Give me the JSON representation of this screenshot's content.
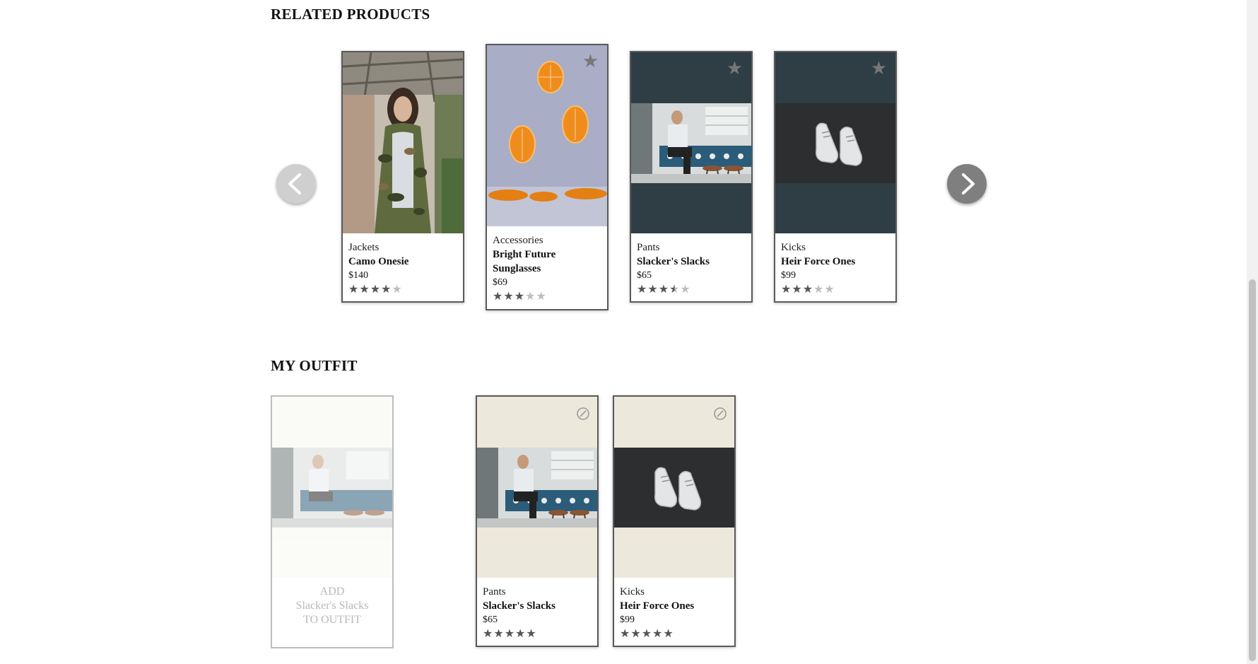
{
  "related": {
    "title": "RELATED PRODUCTS",
    "products": [
      {
        "category": "Jackets",
        "name": "Camo Onesie",
        "price": "$140",
        "rating": 4
      },
      {
        "category": "Accessories",
        "name": "Bright Future Sunglasses",
        "price": "$69",
        "rating": 3
      },
      {
        "category": "Pants",
        "name": "Slacker's Slacks",
        "price": "$65",
        "rating": 3.5
      },
      {
        "category": "Kicks",
        "name": "Heir Force Ones",
        "price": "$99",
        "rating": 3
      }
    ]
  },
  "outfit": {
    "title": "MY OUTFIT",
    "add_card": {
      "line1": "ADD",
      "line2": "Slacker's Slacks",
      "line3": "TO OUTFIT"
    },
    "items": [
      {
        "category": "Pants",
        "name": "Slacker's Slacks",
        "price": "$65",
        "rating": 5
      },
      {
        "category": "Kicks",
        "name": "Heir Force Ones",
        "price": "$99",
        "rating": 5
      }
    ]
  },
  "icons": {
    "star_button": "star-icon",
    "remove_button": "circle-slash-icon",
    "prev": "chevron-left-icon",
    "next": "chevron-right-icon"
  },
  "colors": {
    "dark_photo_bg": "#2f3d44",
    "outfit_photo_bg": "#ede8dc",
    "star_on": "#555555",
    "star_off": "#bdbdbd"
  }
}
